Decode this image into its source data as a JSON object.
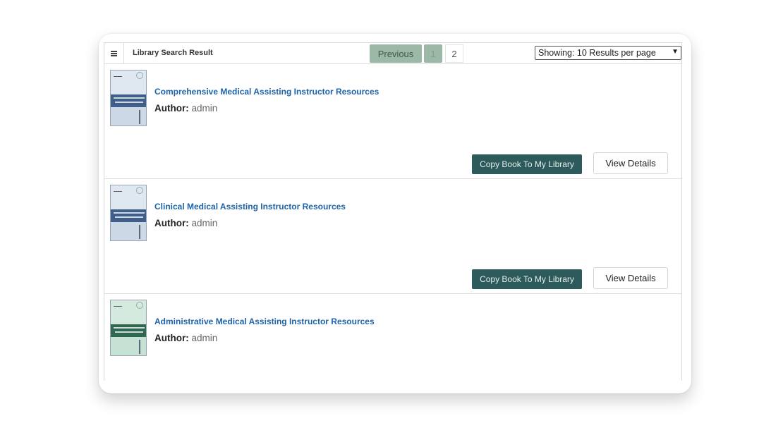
{
  "toolbar": {
    "menu_icon": "hamburger-menu-icon",
    "title": "Library Search Result",
    "previous_label": "Previous",
    "pages": [
      "1",
      "2"
    ],
    "current_page": "1",
    "per_page_label": "Showing: 10 Results per page"
  },
  "books": [
    {
      "title": "Comprehensive Medical Assisting Instructor Resources",
      "author_label": "Author:",
      "author": "admin",
      "copy_label": "Copy Book To My Library",
      "view_label": "View Details",
      "cover_theme": "blue"
    },
    {
      "title": "Clinical Medical Assisting Instructor Resources",
      "author_label": "Author:",
      "author": "admin",
      "copy_label": "Copy Book To My Library",
      "view_label": "View Details",
      "cover_theme": "blue"
    },
    {
      "title": "Administrative Medical Assisting Instructor Resources",
      "author_label": "Author:",
      "author": "admin",
      "cover_theme": "green"
    }
  ],
  "colors": {
    "link": "#1e63a8",
    "pager_active": "#9cb8a6",
    "copy_button": "#2d5a5a"
  }
}
